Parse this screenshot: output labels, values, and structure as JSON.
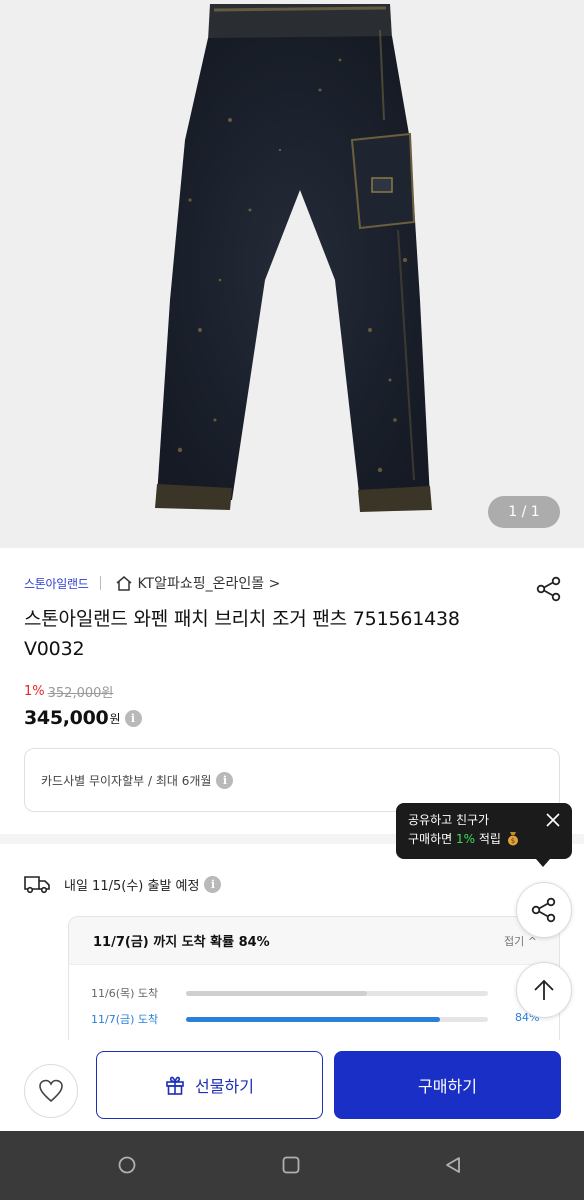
{
  "gallery": {
    "counter": "1 / 1",
    "image_alt": "dark washed jogger pants product photo"
  },
  "breadcrumb": {
    "brand": "스톤아일랜드",
    "store": "KT알파쇼핑_온라인몰 >"
  },
  "product": {
    "title": "스톤아일랜드 와펜 패치 브리치 조거 팬츠 751561438 V0032",
    "discount_rate": "1%",
    "original_price": "352,000원",
    "price": "345,000",
    "currency": "원"
  },
  "installment": {
    "text": "카드사별 무이자할부 / 최대 6개월"
  },
  "share_tooltip": {
    "line1": "공유하고 친구가",
    "line2_prefix": "구매하면 ",
    "line2_highlight": "1%",
    "line2_suffix": " 적립"
  },
  "delivery": {
    "text": "내일 11/5(수) 출발 예정"
  },
  "arrival_probability": {
    "heading": "11/7(금) 까지 도착 확률 84%",
    "toggle": "접기 ^",
    "rows": [
      {
        "label": "11/6(목) 도착",
        "value": 0.6,
        "pct": ""
      },
      {
        "label": "11/7(금) 도착",
        "value": 0.84,
        "pct": "84%"
      }
    ]
  },
  "actions": {
    "gift_label": "선물하기",
    "buy_label": "구매하기"
  },
  "colors": {
    "brand_blue": "#1a2fc5",
    "discount_red": "#e8262c",
    "progress_blue": "#2a80d8",
    "highlight_green": "#3ddc57"
  },
  "icons": [
    "home-icon",
    "share-icon",
    "info-icon",
    "close-icon",
    "money-bag-icon",
    "truck-icon",
    "arrow-up-icon",
    "heart-icon",
    "gift-icon",
    "nav-home-icon",
    "nav-recents-icon",
    "nav-back-icon"
  ]
}
